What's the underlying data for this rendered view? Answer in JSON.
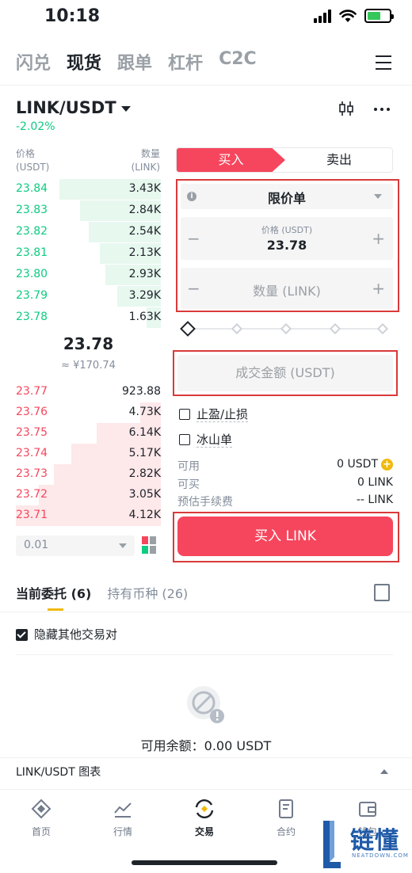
{
  "status": {
    "time": "10:18"
  },
  "top_tabs": [
    {
      "label": "闪兑",
      "active": false
    },
    {
      "label": "现货",
      "active": true
    },
    {
      "label": "跟单",
      "active": false
    },
    {
      "label": "杠杆",
      "active": false
    },
    {
      "label": "C2C",
      "active": false
    }
  ],
  "pair": {
    "symbol": "LINK/USDT",
    "change": "-2.02%"
  },
  "orderbook": {
    "price_header": "价格",
    "price_unit": "(USDT)",
    "qty_header": "数量",
    "qty_unit": "(LINK)",
    "bids": [
      {
        "price": "23.84",
        "qty": "3.43K",
        "depth": 0.7
      },
      {
        "price": "23.83",
        "qty": "2.84K",
        "depth": 0.56
      },
      {
        "price": "23.82",
        "qty": "2.54K",
        "depth": 0.5
      },
      {
        "price": "23.81",
        "qty": "2.13K",
        "depth": 0.42
      },
      {
        "price": "23.80",
        "qty": "2.93K",
        "depth": 0.38
      },
      {
        "price": "23.79",
        "qty": "3.29K",
        "depth": 0.3
      },
      {
        "price": "23.78",
        "qty": "1.63K",
        "depth": 0.1
      }
    ],
    "mid_price": "23.78",
    "mid_fiat": "≈ ¥170.74",
    "asks": [
      {
        "price": "23.77",
        "qty": "923.88",
        "depth": 0.0
      },
      {
        "price": "23.76",
        "qty": "4.73K",
        "depth": 0.14
      },
      {
        "price": "23.75",
        "qty": "6.14K",
        "depth": 0.44
      },
      {
        "price": "23.74",
        "qty": "5.17K",
        "depth": 0.62
      },
      {
        "price": "23.73",
        "qty": "2.82K",
        "depth": 0.74
      },
      {
        "price": "23.72",
        "qty": "3.05K",
        "depth": 0.84
      },
      {
        "price": "23.71",
        "qty": "4.12K",
        "depth": 1.0
      }
    ],
    "depth_step": "0.01"
  },
  "form": {
    "buy_tab": "买入",
    "sell_tab": "卖出",
    "order_type": "限价单",
    "price_caption": "价格 (USDT)",
    "price_value": "23.78",
    "qty_placeholder": "数量 (LINK)",
    "amount_placeholder": "成交金额 (USDT)",
    "slider_level": 0,
    "stop_label": "止盈/止损",
    "iceberg_label": "冰山单",
    "available_label": "可用",
    "available_value": "0 USDT",
    "buyable_label": "可买",
    "buyable_value": "0 LINK",
    "fee_label": "预估手续费",
    "fee_value": "-- LINK",
    "buy_button": "买入 LINK",
    "minus": "−",
    "plus": "+"
  },
  "lower": {
    "tab_open": "当前委托 (6)",
    "tab_holdings": "持有币种 (26)",
    "hide_pairs": "隐藏其他交易对",
    "balance": "可用余额：0.00 USDT",
    "chart_label": "LINK/USDT 图表"
  },
  "nav": [
    {
      "label": "首页",
      "icon": "home-icon"
    },
    {
      "label": "行情",
      "icon": "markets-icon"
    },
    {
      "label": "交易",
      "icon": "trade-icon",
      "active": true
    },
    {
      "label": "合约",
      "icon": "futures-icon"
    },
    {
      "label": "钱包",
      "icon": "wallet-icon"
    }
  ],
  "watermark": {
    "name": "链懂",
    "sub": "NEATDOWN.COM"
  },
  "colors": {
    "buy": "#0ecb81",
    "sell": "#f6465d",
    "accent": "#f0b90b",
    "highlight": "#d93a3a"
  }
}
